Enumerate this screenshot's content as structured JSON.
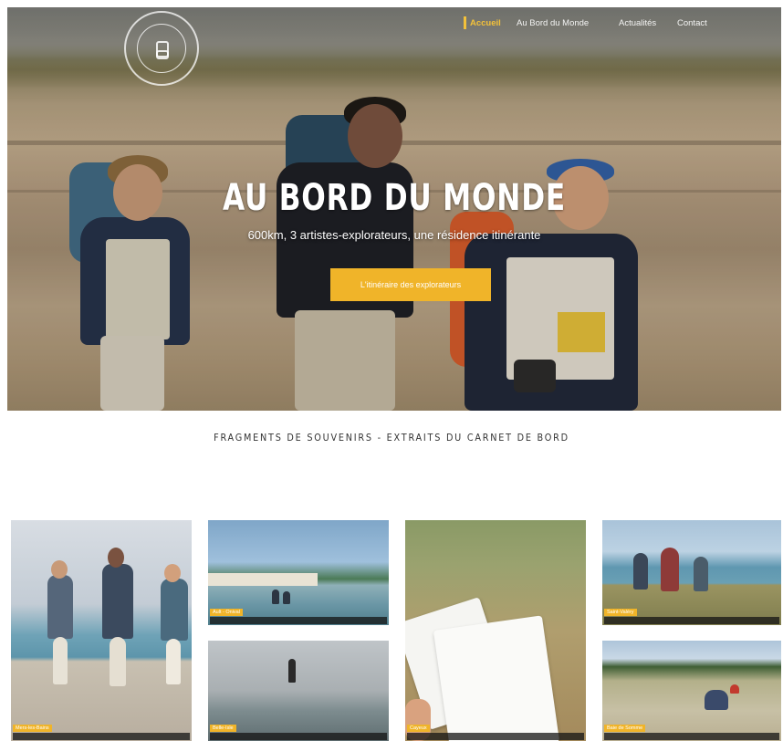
{
  "nav": {
    "items": [
      {
        "label": "Accueil",
        "active": true
      },
      {
        "label": "Au Bord du Monde",
        "active": false
      },
      {
        "label": "Actualités",
        "active": false
      },
      {
        "label": "Contact",
        "active": false
      }
    ]
  },
  "hero": {
    "title": "AU BORD DU MONDE",
    "subtitle": "600km, 3 artistes-explorateurs, une résidence itinérante",
    "cta_label": "L'itinéraire des explorateurs"
  },
  "section": {
    "title": "FRAGMENTS DE SOUVENIRS - EXTRAITS DU CARNET DE BORD"
  },
  "gallery": {
    "cards": [
      {
        "tag": "Mers-les-Bains"
      },
      {
        "tag": "Ault - Onival"
      },
      {
        "tag": "Belle-Isle"
      },
      {
        "tag": "Cayeux"
      },
      {
        "tag": "Saint-Valéry"
      },
      {
        "tag": "Baie de Somme"
      }
    ]
  },
  "colors": {
    "accent": "#f0b429",
    "nav_active": "#f3c13a",
    "caption_bg": "#141414"
  }
}
